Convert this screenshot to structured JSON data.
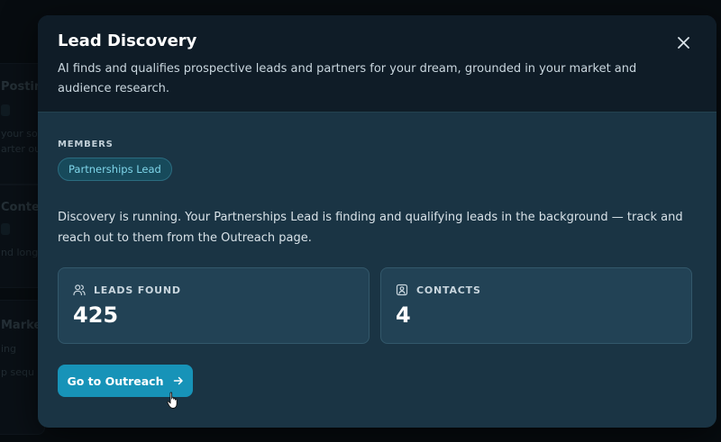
{
  "background": {
    "cards": [
      {
        "title": "Posting",
        "text1": "your soc",
        "text2": "arter ou"
      },
      {
        "title": "Content",
        "text1": "nd long-",
        "text2": ""
      },
      {
        "title": "Marketi",
        "text1": "ing",
        "text2": "p sequ"
      }
    ]
  },
  "modal": {
    "title": "Lead Discovery",
    "description": "AI finds and qualifies prospective leads and partners for your dream, grounded in your market and audience research.",
    "members_label": "MEMBERS",
    "members": [
      "Partnerships Lead"
    ],
    "status": "Discovery is running. Your Partnerships Lead is finding and qualifying leads in the background — track and reach out to them from the Outreach page.",
    "stats": [
      {
        "label": "LEADS FOUND",
        "value": "425",
        "icon": "users-icon"
      },
      {
        "label": "CONTACTS",
        "value": "4",
        "icon": "contact-card-icon"
      }
    ],
    "cta_label": "Go to Outreach",
    "colors": {
      "accent": "#1793b8",
      "chip_text": "#7fd6ea",
      "surface": "#1a3444",
      "header": "#0f1c27"
    }
  }
}
